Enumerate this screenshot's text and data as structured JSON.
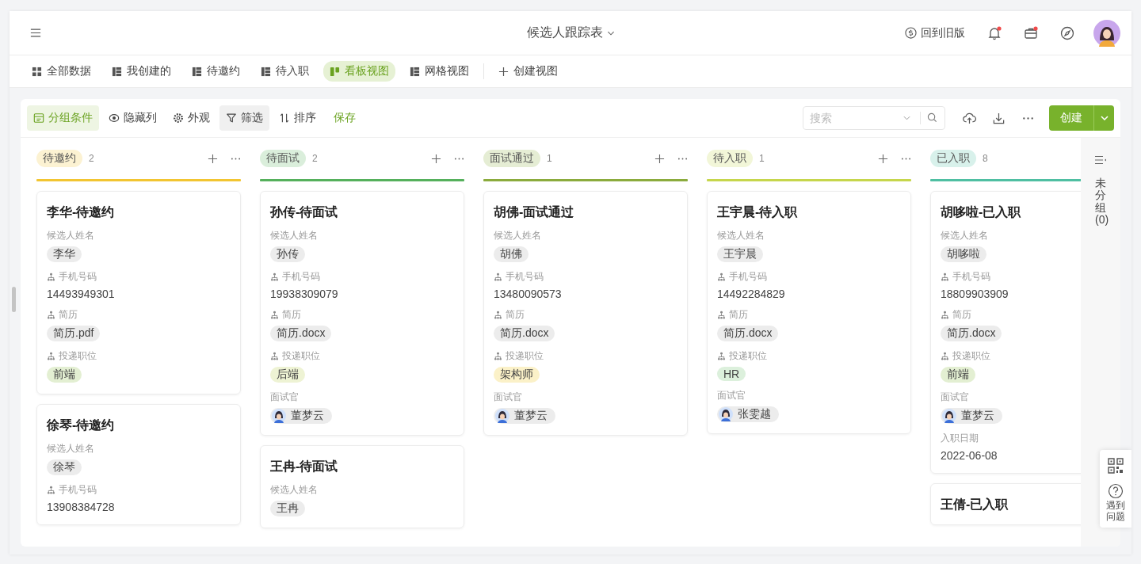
{
  "top_bar": {
    "title": "候选人跟踪表",
    "back_link": "回到旧版",
    "bell_dot": true,
    "inbox_dot": true
  },
  "views": [
    {
      "label": "全部数据",
      "kind": "grid",
      "selected": false
    },
    {
      "label": "我创建的",
      "kind": "table",
      "selected": false
    },
    {
      "label": "待邀约",
      "kind": "table",
      "selected": false
    },
    {
      "label": "待入职",
      "kind": "table",
      "selected": false
    },
    {
      "label": "看板视图",
      "kind": "kanban",
      "selected": true
    },
    {
      "label": "网格视图",
      "kind": "table",
      "selected": false
    }
  ],
  "create_view": "创建视图",
  "toolbar": {
    "tools": [
      {
        "label": "分组条件",
        "selected": true,
        "highlighted": false
      },
      {
        "label": "隐藏列",
        "selected": false,
        "highlighted": false
      },
      {
        "label": "外观",
        "selected": false,
        "highlighted": false
      },
      {
        "label": "筛选",
        "selected": false,
        "highlighted": true
      },
      {
        "label": "排序",
        "selected": false,
        "highlighted": false
      }
    ],
    "save_link": "保存",
    "search": {
      "placeholder": "搜索"
    },
    "create_button": "创建"
  },
  "columns": [
    {
      "label": "待邀约",
      "count": "2",
      "color": "#f2c531",
      "cards": [
        {
          "title": "李华-待邀约",
          "fields": [
            {
              "label": "候选人姓名",
              "linked": false,
              "kind": "chip",
              "value": "李华",
              "color": "#ececec"
            },
            {
              "label": "手机号码",
              "linked": true,
              "kind": "text",
              "value": "14493949301"
            },
            {
              "label": "简历",
              "linked": true,
              "kind": "chip",
              "value": "简历.pdf",
              "color": "#ececec"
            },
            {
              "label": "投递职位",
              "linked": true,
              "kind": "chip",
              "value": "前端",
              "color": "#e3efd2"
            }
          ]
        },
        {
          "title": "徐琴-待邀约",
          "fields": [
            {
              "label": "候选人姓名",
              "linked": false,
              "kind": "chip",
              "value": "徐琴",
              "color": "#ececec"
            },
            {
              "label": "手机号码",
              "linked": true,
              "kind": "text",
              "value": "13908384728"
            }
          ]
        }
      ]
    },
    {
      "label": "待面试",
      "count": "2",
      "color": "#55b05c",
      "cards": [
        {
          "title": "孙传-待面试",
          "fields": [
            {
              "label": "候选人姓名",
              "linked": false,
              "kind": "chip",
              "value": "孙传",
              "color": "#ececec"
            },
            {
              "label": "手机号码",
              "linked": true,
              "kind": "text",
              "value": "19938309079"
            },
            {
              "label": "简历",
              "linked": true,
              "kind": "chip",
              "value": "简历.docx",
              "color": "#ececec"
            },
            {
              "label": "投递职位",
              "linked": true,
              "kind": "chip",
              "value": "后端",
              "color": "#eef3d4"
            },
            {
              "label": "面试官",
              "linked": false,
              "kind": "person",
              "value": "董梦云"
            }
          ]
        },
        {
          "title": "王冉-待面试",
          "fields": [
            {
              "label": "候选人姓名",
              "linked": false,
              "kind": "chip",
              "value": "王冉",
              "color": "#ececec"
            }
          ]
        }
      ]
    },
    {
      "label": "面试通过",
      "count": "1",
      "color": "#8bab3d",
      "cards": [
        {
          "title": "胡佛-面试通过",
          "fields": [
            {
              "label": "候选人姓名",
              "linked": false,
              "kind": "chip",
              "value": "胡佛",
              "color": "#ececec"
            },
            {
              "label": "手机号码",
              "linked": true,
              "kind": "text",
              "value": "13480090573"
            },
            {
              "label": "简历",
              "linked": true,
              "kind": "chip",
              "value": "简历.docx",
              "color": "#ececec"
            },
            {
              "label": "投递职位",
              "linked": true,
              "kind": "chip",
              "value": "架构师",
              "color": "#fbf1c8"
            },
            {
              "label": "面试官",
              "linked": false,
              "kind": "person",
              "value": "董梦云"
            }
          ]
        }
      ]
    },
    {
      "label": "待入职",
      "count": "1",
      "color": "#c6d64c",
      "cards": [
        {
          "title": "王宇晨-待入职",
          "fields": [
            {
              "label": "候选人姓名",
              "linked": false,
              "kind": "chip",
              "value": "王宇晨",
              "color": "#ececec"
            },
            {
              "label": "手机号码",
              "linked": true,
              "kind": "text",
              "value": "14492284829"
            },
            {
              "label": "简历",
              "linked": true,
              "kind": "chip",
              "value": "简历.docx",
              "color": "#ececec"
            },
            {
              "label": "投递职位",
              "linked": true,
              "kind": "chip",
              "value": "HR",
              "color": "#dcf0dc"
            },
            {
              "label": "面试官",
              "linked": false,
              "kind": "person",
              "value": "张雯越"
            }
          ]
        }
      ]
    },
    {
      "label": "已入职",
      "count": "8",
      "color": "#4fbfa2",
      "cards": [
        {
          "title": "胡哆啦-已入职",
          "fields": [
            {
              "label": "候选人姓名",
              "linked": false,
              "kind": "chip",
              "value": "胡哆啦",
              "color": "#ececec"
            },
            {
              "label": "手机号码",
              "linked": true,
              "kind": "text",
              "value": "18809903909"
            },
            {
              "label": "简历",
              "linked": true,
              "kind": "chip",
              "value": "简历.docx",
              "color": "#ececec"
            },
            {
              "label": "投递职位",
              "linked": true,
              "kind": "chip",
              "value": "前端",
              "color": "#e3efd2"
            },
            {
              "label": "面试官",
              "linked": false,
              "kind": "person",
              "value": "董梦云"
            },
            {
              "label": "入职日期",
              "linked": false,
              "kind": "text",
              "value": "2022-06-08"
            }
          ]
        },
        {
          "title": "王倩-已入职"
        }
      ]
    }
  ],
  "ungrouped": "未分组 (0)",
  "help_label": "遇到问题"
}
